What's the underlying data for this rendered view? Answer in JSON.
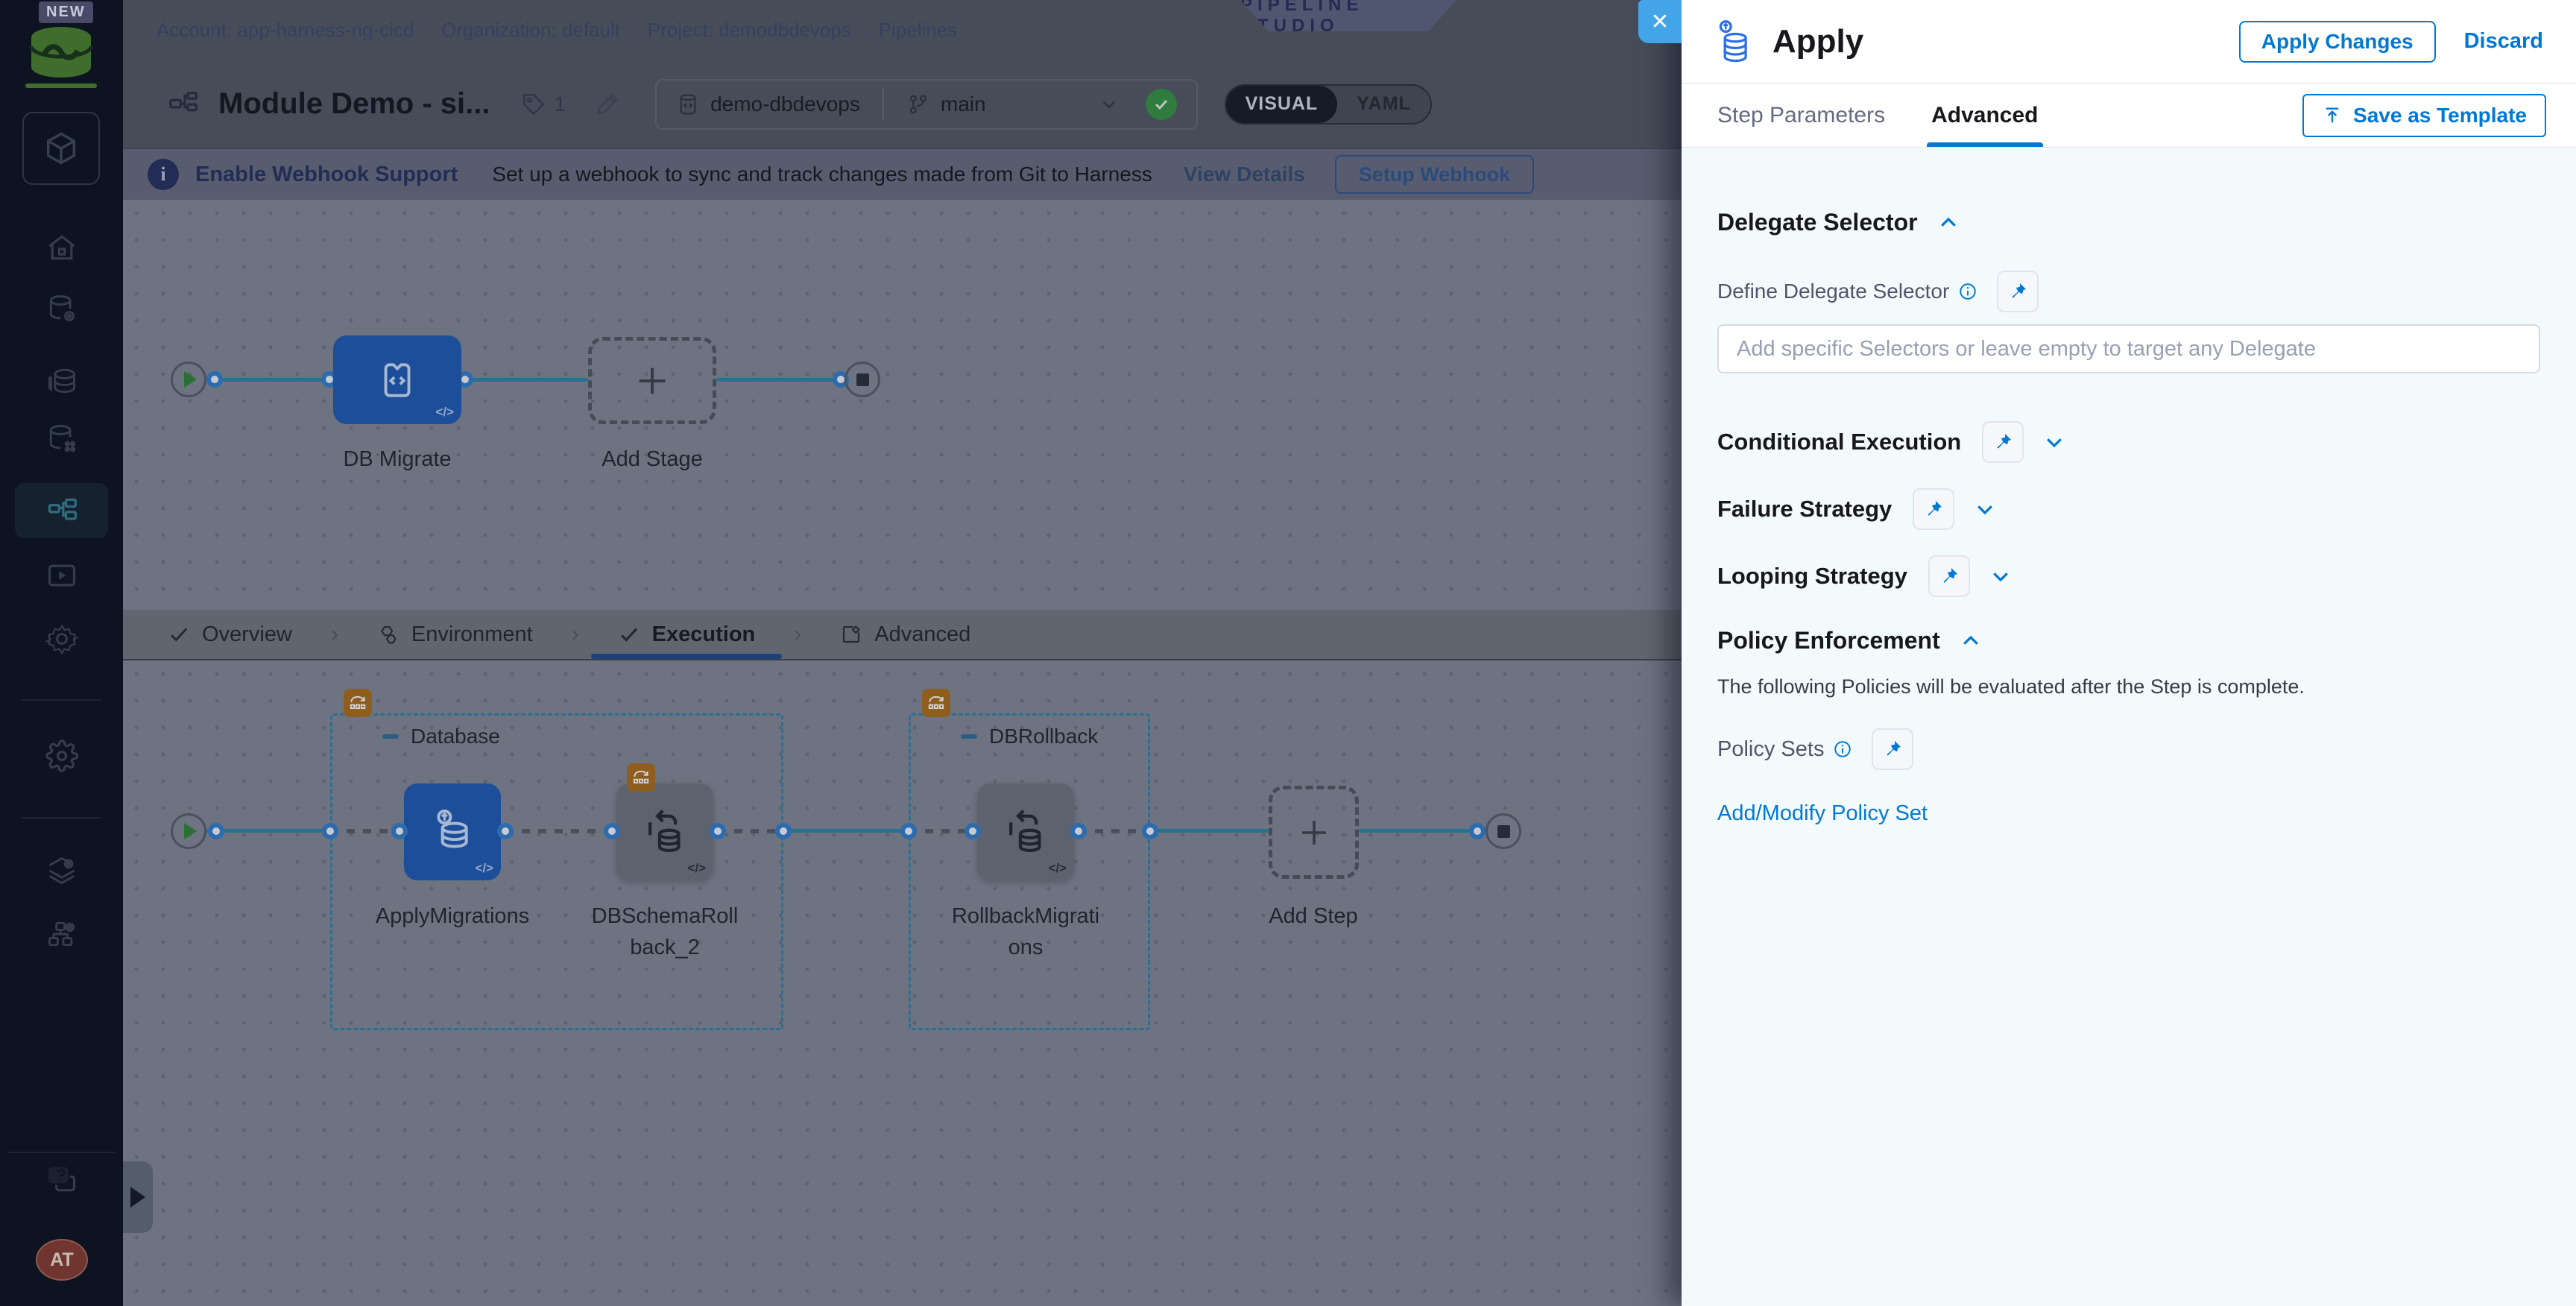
{
  "app": {
    "close_glyph": "✕"
  },
  "sidebar": {
    "new_badge": "NEW",
    "avatar_initials": "AT",
    "icons": [
      "harness-db-logo",
      "module-cube",
      "home",
      "database-gear",
      "database-stack",
      "database-grid",
      "pipelines",
      "executions",
      "settings",
      "account-settings",
      "layers-settings",
      "org-settings",
      "help-chat",
      "avatar"
    ]
  },
  "breadcrumb": {
    "separator": "›",
    "items": [
      {
        "label": "Account: app-harness-ng-cicd"
      },
      {
        "label": "Organization: default"
      },
      {
        "label": "Project: demodbdevops"
      },
      {
        "label": "Pipelines"
      }
    ]
  },
  "topbar": {
    "studio_badge": "PIPELINE STUDIO"
  },
  "header": {
    "title": "Module Demo - si...",
    "tag_count": "1",
    "repo_name": "demo-dbdevops",
    "branch_name": "main",
    "visual_label": "VISUAL",
    "yaml_label": "YAML"
  },
  "banner": {
    "title": "Enable Webhook Support",
    "description": "Set up a webhook to sync and track changes made from Git to Harness",
    "view_details": "View Details",
    "setup_button": "Setup Webhook"
  },
  "stage_canvas": {
    "stage_label": "DB Migrate",
    "add_stage_label": "Add Stage"
  },
  "nav_tabs": {
    "items": [
      {
        "label": "Overview"
      },
      {
        "label": "Environment"
      },
      {
        "label": "Execution"
      },
      {
        "label": "Advanced"
      }
    ]
  },
  "execution": {
    "group1_label": "Database",
    "group2_label": "DBRollback",
    "step1_label": "ApplyMigrations",
    "step2_label": "DBSchemaRollback_2",
    "step3_label": "RollbackMigrations",
    "add_step_label": "Add Step",
    "code_glyph": "</>"
  },
  "drawer": {
    "title": "Apply",
    "apply_button": "Apply Changes",
    "discard_button": "Discard",
    "tab_step_parameters": "Step Parameters",
    "tab_advanced": "Advanced",
    "save_as_template": "Save as Template",
    "delegate": {
      "section_title": "Delegate Selector",
      "label": "Define Delegate Selector",
      "placeholder": "Add specific Selectors or leave empty to target any Delegate"
    },
    "sections": {
      "conditional": "Conditional Execution",
      "failure": "Failure Strategy",
      "looping": "Looping Strategy"
    },
    "policy": {
      "section_title": "Policy Enforcement",
      "description": "The following Policies will be evaluated after the Step is complete.",
      "label": "Policy Sets",
      "link": "Add/Modify Policy Set"
    }
  },
  "colors": {
    "accent_blue": "#0278d5",
    "close_button": "#41a5e8",
    "node_blue_dimmed": "#1d4e99",
    "connector_teal_dimmed": "#27728f",
    "group_badge_orange_dimmed": "#8f5e1e",
    "git_check_green_dimmed": "#2f7c3e",
    "sidebar_navy_dimmed": "#0d1321"
  }
}
